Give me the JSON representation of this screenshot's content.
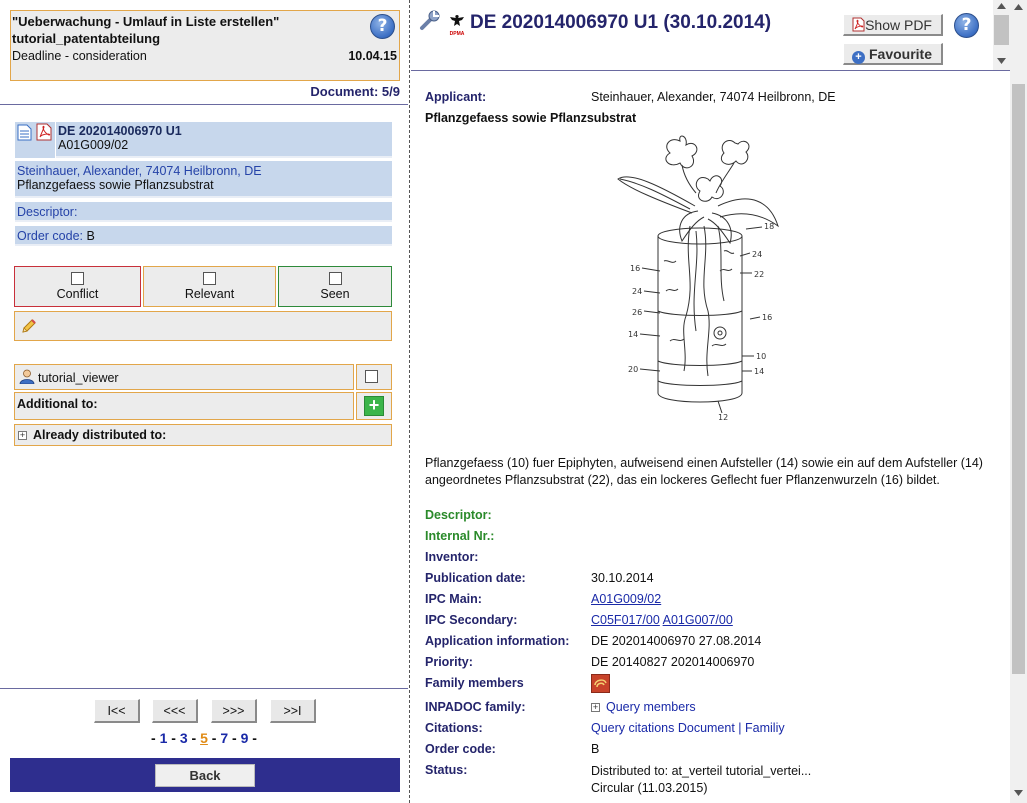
{
  "task": {
    "title": "\"Ueberwachung - Umlauf in Liste erstellen\" tutorial_patentabteilung",
    "deadline_label": "Deadline - consideration",
    "deadline_value": "10.04.15",
    "help_label": "?",
    "document_counter": "Document: 5/9"
  },
  "summary": {
    "number": "DE 202014006970 U1",
    "ipc": "A01G009/02",
    "applicant": "Steinhauer, Alexander, 74074 Heilbronn, DE",
    "title": "Pflanzgefaess sowie Pflanzsubstrat",
    "descriptor_label": "Descriptor:",
    "order_code_label": "Order code:",
    "order_code_value": "B"
  },
  "status_buttons": {
    "conflict": "Conflict",
    "relevant": "Relevant",
    "seen": "Seen"
  },
  "distribution": {
    "viewer": "tutorial_viewer",
    "additional_label": "Additional to:",
    "add_symbol": "+",
    "already_distributed_label": "Already distributed to:",
    "expander_symbol": "+"
  },
  "navigation": {
    "first": "I<<",
    "prev": "<<<",
    "next": ">>>",
    "last": ">>I",
    "pages": [
      "1",
      "3",
      "5",
      "7",
      "9"
    ],
    "current_page": "5",
    "separator": "-",
    "back": "Back"
  },
  "detail": {
    "header_title": "DE 202014006970 U1 (30.10.2014)",
    "show_pdf": "Show PDF",
    "favourite": "Favourite",
    "favourite_symbol": "+",
    "help_label": "?",
    "eagle_label": "DPMA",
    "applicant_label": "Applicant:",
    "applicant_value": "Steinhauer, Alexander, 74074 Heilbronn, DE",
    "title": "Pflanzgefaess sowie Pflanzsubstrat",
    "drawing_labels": [
      "18",
      "24",
      "22",
      "16",
      "24",
      "26",
      "14",
      "16",
      "10",
      "20",
      "14",
      "12"
    ],
    "abstract": "Pflanzgefaess (10) fuer Epiphyten, aufweisend einen Aufsteller (14) sowie ein auf dem Aufsteller (14) angeordnetes Pflanzsubstrat (22), das ein lockeres Geflecht fuer Pflanzenwurzeln (16) bildet.",
    "descriptor_label": "Descriptor:",
    "internal_nr_label": "Internal Nr.:",
    "inventor_label": "Inventor:",
    "publication_date_label": "Publication date:",
    "publication_date_value": "30.10.2014",
    "ipc_main_label": "IPC Main:",
    "ipc_main_value": "A01G009/02",
    "ipc_secondary_label": "IPC Secondary:",
    "ipc_secondary_values": [
      "C05F017/00",
      "A01G007/00"
    ],
    "application_info_label": "Application information:",
    "application_info_value": "DE 202014006970 27.08.2014",
    "priority_label": "Priority:",
    "priority_value": "DE 20140827 202014006970",
    "family_members_label": "Family members",
    "inpadoc_label": "INPADOC family:",
    "inpadoc_expander": "+",
    "inpadoc_value": "Query members",
    "citations_label": "Citations:",
    "citations_document": "Query citations Document",
    "citations_separator": "|",
    "citations_family": "Familiy",
    "order_code_label": "Order code:",
    "order_code_value": "B",
    "status_label": "Status:",
    "status_line1": "Distributed to: at_verteil tutorial_vertei...",
    "status_line2": "Circular (11.03.2015)"
  },
  "colors": {
    "accent_navy": "#24246b",
    "link_blue": "#1a2aa8",
    "orange_border": "#e2a64a",
    "conflict_red": "#c8303a",
    "seen_green": "#2e8a3a",
    "bottom_bar": "#2e2e8e",
    "summary_blue": "#c7d7ec"
  }
}
